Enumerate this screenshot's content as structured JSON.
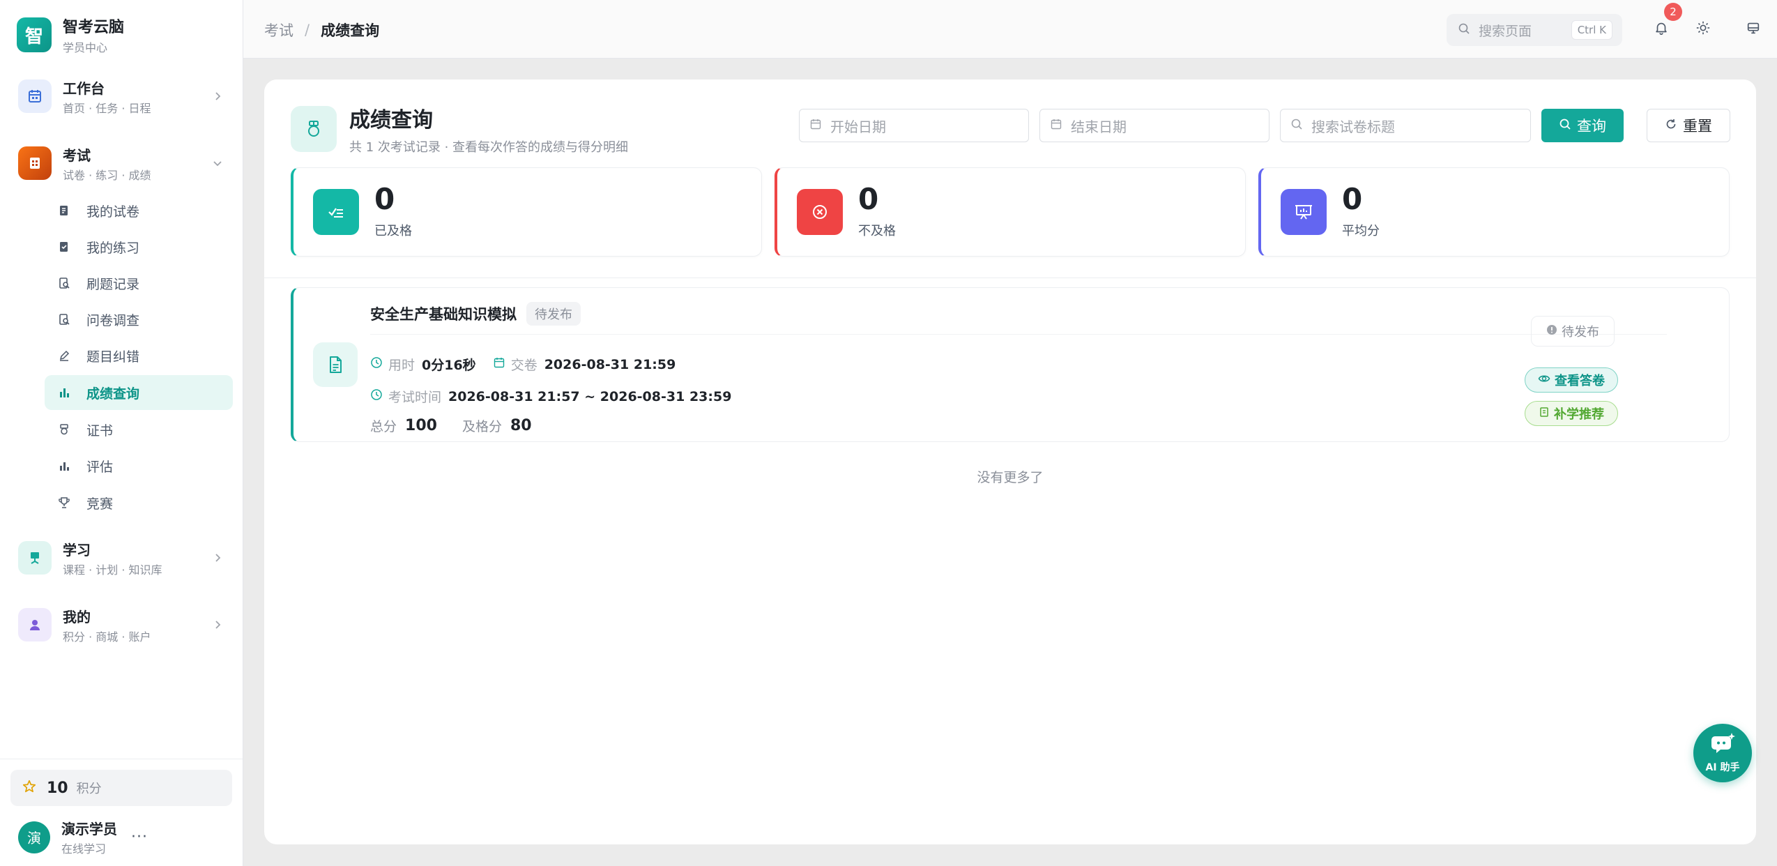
{
  "brand": {
    "logo_char": "智",
    "name": "智考云脑",
    "subtitle": "学员中心"
  },
  "nav": {
    "workbench": {
      "title": "工作台",
      "subtitle": "首页 · 任务 · 日程"
    },
    "exam": {
      "title": "考试",
      "subtitle": "试卷 · 练习 · 成绩",
      "items": [
        {
          "label": "我的试卷"
        },
        {
          "label": "我的练习"
        },
        {
          "label": "刷题记录"
        },
        {
          "label": "问卷调查"
        },
        {
          "label": "题目纠错"
        },
        {
          "label": "成绩查询"
        },
        {
          "label": "证书"
        },
        {
          "label": "评估"
        },
        {
          "label": "竞赛"
        }
      ]
    },
    "study": {
      "title": "学习",
      "subtitle": "课程 · 计划 · 知识库"
    },
    "mine": {
      "title": "我的",
      "subtitle": "积分 · 商城 · 账户"
    }
  },
  "points": {
    "value": "10",
    "unit": "积分"
  },
  "user": {
    "avatar_char": "演",
    "name": "演示学员",
    "status": "在线学习",
    "more": "···"
  },
  "header": {
    "breadcrumb_parent": "考试",
    "breadcrumb_sep": "/",
    "breadcrumb_current": "成绩查询",
    "search_placeholder": "搜索页面",
    "search_shortcut": "Ctrl K",
    "notification_count": "2"
  },
  "page": {
    "title": "成绩查询",
    "subtitle": "共 1 次考试记录 · 查看每次作答的成绩与得分明细"
  },
  "filters": {
    "start_date_placeholder": "开始日期",
    "end_date_placeholder": "结束日期",
    "keyword_placeholder": "搜索试卷标题",
    "query_label": "查询",
    "reset_label": "重置"
  },
  "stats": [
    {
      "value": "0",
      "label": "已及格",
      "color": "#14b8a6"
    },
    {
      "value": "0",
      "label": "不及格",
      "color": "#ef4444"
    },
    {
      "value": "0",
      "label": "平均分",
      "color": "#6366f1"
    }
  ],
  "record": {
    "title": "安全生产基础知识模拟",
    "tag": "待发布",
    "duration_label": "用时",
    "duration": "0分16秒",
    "submit_label": "交卷",
    "submit_time": "2026-08-31 21:59",
    "exam_time_label": "考试时间",
    "exam_time": "2026-08-31 21:57 ~ 2026-08-31 23:59",
    "total_label": "总分",
    "total": "100",
    "pass_label": "及格分",
    "pass": "80",
    "status": "待发布",
    "view_label": "查看答卷",
    "recommend_label": "补学推荐"
  },
  "list_end": "没有更多了",
  "ai": {
    "label": "AI 助手"
  },
  "colors": {
    "accent": "#14a89a",
    "danger": "#ef4444",
    "indigo": "#6366f1",
    "exam_orange": "#ea580c"
  }
}
